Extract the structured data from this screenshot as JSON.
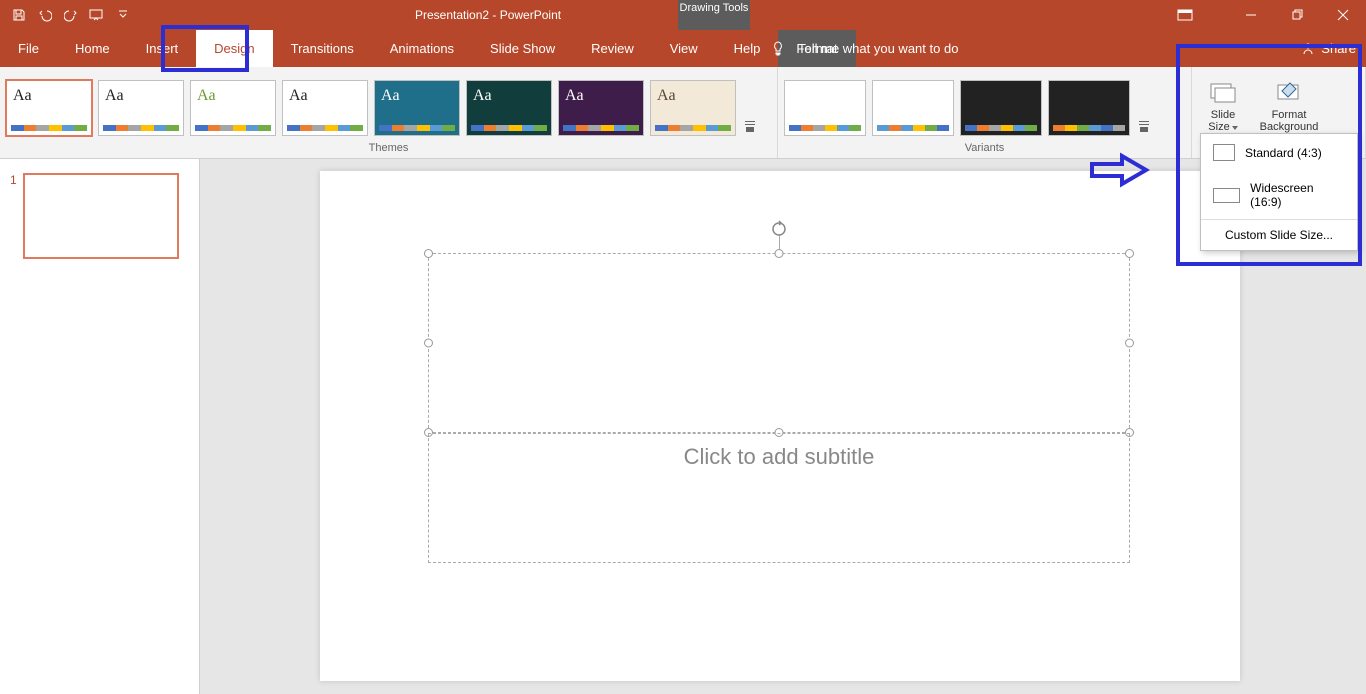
{
  "titlebar": {
    "title": "Presentation2 - PowerPoint",
    "qat": {
      "save": "save",
      "undo": "undo",
      "redo": "redo",
      "start": "start-from-beginning"
    },
    "contextual_tab": "Drawing Tools"
  },
  "tabs": {
    "file": "File",
    "home": "Home",
    "insert": "Insert",
    "design": "Design",
    "transitions": "Transitions",
    "animations": "Animations",
    "slideshow": "Slide Show",
    "review": "Review",
    "view": "View",
    "help": "Help",
    "format": "Format"
  },
  "tellme": {
    "placeholder": "Tell me what you want to do"
  },
  "share": {
    "label": "Share"
  },
  "ribbon": {
    "themes_label": "Themes",
    "variants_label": "Variants",
    "customize": {
      "slide_size": "Slide Size",
      "format_bg": "Format Background"
    }
  },
  "slide_size_menu": {
    "standard": "Standard (4:3)",
    "widescreen": "Widescreen (16:9)",
    "custom": "Custom Slide Size..."
  },
  "themes": [
    {
      "bg": "#ffffff",
      "fg": "#222",
      "aa": "Aa"
    },
    {
      "bg": "#ffffff",
      "fg": "#222",
      "aa": "Aa"
    },
    {
      "bg": "#ffffff",
      "fg": "#6b9b2e",
      "aa": "Aa",
      "accent": "#6b9b2e"
    },
    {
      "bg": "#ffffff",
      "fg": "#222",
      "aa": "Aa"
    },
    {
      "bg": "#1f6f8b",
      "fg": "#fff",
      "aa": "Aa"
    },
    {
      "bg": "#123d3d",
      "fg": "#fff",
      "aa": "Aa"
    },
    {
      "bg": "#3f1d4a",
      "fg": "#fff",
      "aa": "Aa"
    },
    {
      "bg": "#f2e9d8",
      "fg": "#5a4632",
      "aa": "Aa"
    }
  ],
  "variant_colors": [
    [
      "#4472c4",
      "#ed7d31",
      "#a5a5a5",
      "#ffc000",
      "#5b9bd5",
      "#70ad47"
    ],
    [
      "#5b9bd5",
      "#ed7d31",
      "#5b9bd5",
      "#ffc000",
      "#70ad47",
      "#4472c4"
    ],
    [
      "#4472c4",
      "#ed7d31",
      "#a5a5a5",
      "#ffc000",
      "#5b9bd5",
      "#70ad47"
    ],
    [
      "#ed7d31",
      "#ffc000",
      "#70ad47",
      "#5b9bd5",
      "#4472c4",
      "#a5a5a5"
    ]
  ],
  "workarea": {
    "slide_number": "1",
    "subtitle_placeholder": "Click to add subtitle"
  },
  "colors": {
    "brand": "#b7472a",
    "highlight": "#2d2dd4"
  }
}
